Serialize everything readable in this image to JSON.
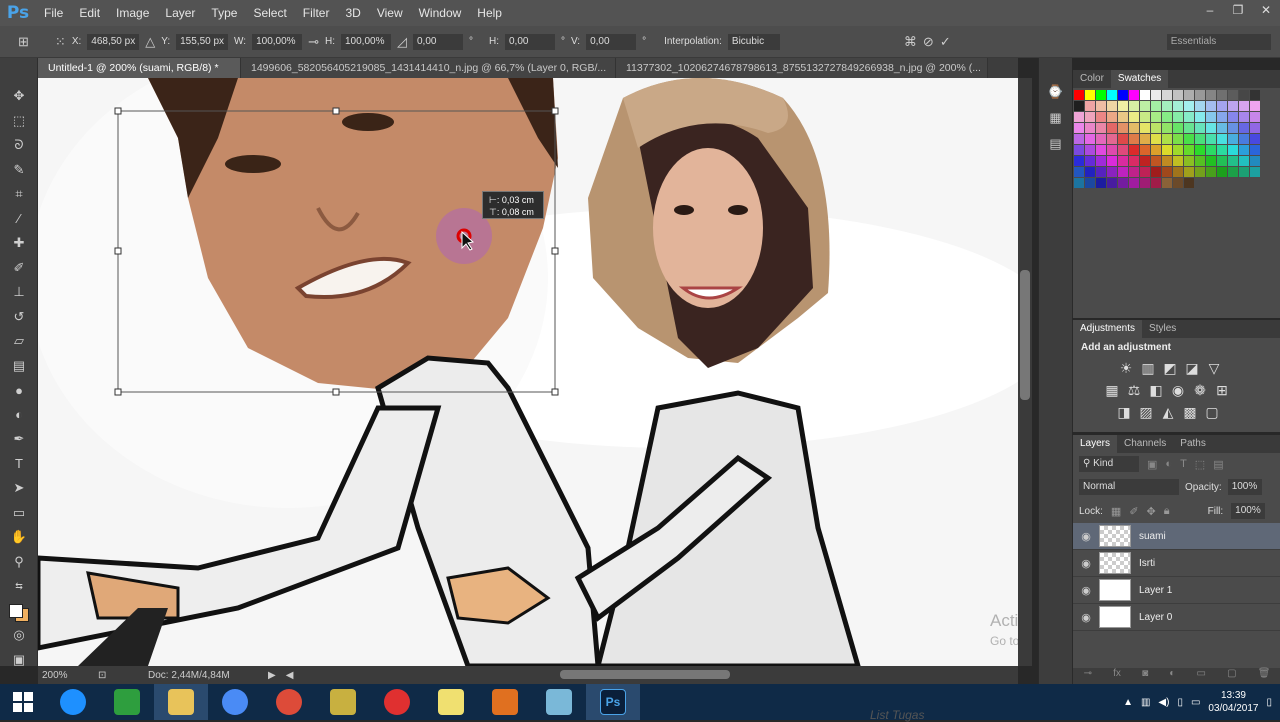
{
  "app": {
    "logo": "Ps"
  },
  "menu": [
    "File",
    "Edit",
    "Image",
    "Layer",
    "Type",
    "Select",
    "Filter",
    "3D",
    "View",
    "Window",
    "Help"
  ],
  "window_controls": {
    "minimize": "–",
    "restore": "❐",
    "close": "✕"
  },
  "options": {
    "x_label": "X:",
    "x_value": "468,50 px",
    "y_label": "Y:",
    "y_value": "155,50 px",
    "w_label": "W:",
    "w_value": "100,00%",
    "h_label": "H:",
    "h_value": "100,00%",
    "angle_value": "0,00",
    "deg": "°",
    "hskew_label": "H:",
    "hskew_value": "0,00",
    "vskew_label": "V:",
    "vskew_value": "0,00",
    "interp_label": "Interpolation:",
    "interp_value": "Bicubic",
    "workspace": "Essentials"
  },
  "tabs": [
    {
      "label": "Untitled-1 @ 200% (suami, RGB/8) *",
      "active": true
    },
    {
      "label": "1499606_582056405219085_1431414410_n.jpg @ 66,7% (Layer 0, RGB/...",
      "active": false
    },
    {
      "label": "11377302_10206274678798613_8755132727849266938_n.jpg @ 200% (...",
      "active": false
    }
  ],
  "tooltip": {
    "line1": "⊢: 0,03 cm",
    "line2": "⊤: 0,08 cm"
  },
  "status": {
    "zoom": "200%",
    "doc": "Doc: 2,44M/4,84M"
  },
  "panels": {
    "color_tabs": [
      "Color",
      "Swatches"
    ],
    "adjust_tabs": [
      "Adjustments",
      "Styles"
    ],
    "adjust_title": "Add an adjustment",
    "layers_tabs": [
      "Layers",
      "Channels",
      "Paths"
    ],
    "kind": "Kind",
    "blend": "Normal",
    "opacity_label": "Opacity:",
    "opacity_value": "100%",
    "lock_label": "Lock:",
    "fill_label": "Fill:",
    "fill_value": "100%"
  },
  "layers": [
    {
      "name": "suami",
      "selected": true
    },
    {
      "name": "Isrti",
      "selected": false
    },
    {
      "name": "Layer 1",
      "selected": false
    },
    {
      "name": "Layer 0",
      "selected": false
    }
  ],
  "watermark": {
    "line1": "Activate Windows",
    "line2": "Go to PC settings to activate Windows."
  },
  "taskbar_overlay": "List Tugas",
  "clock": {
    "time": "13:39",
    "date": "03/04/2017"
  },
  "colors": {
    "accent": "#4aa3e8",
    "taskbar": "#0f2a47",
    "canvas": "#f6f6f6",
    "selected_layer": "#5f6877"
  }
}
